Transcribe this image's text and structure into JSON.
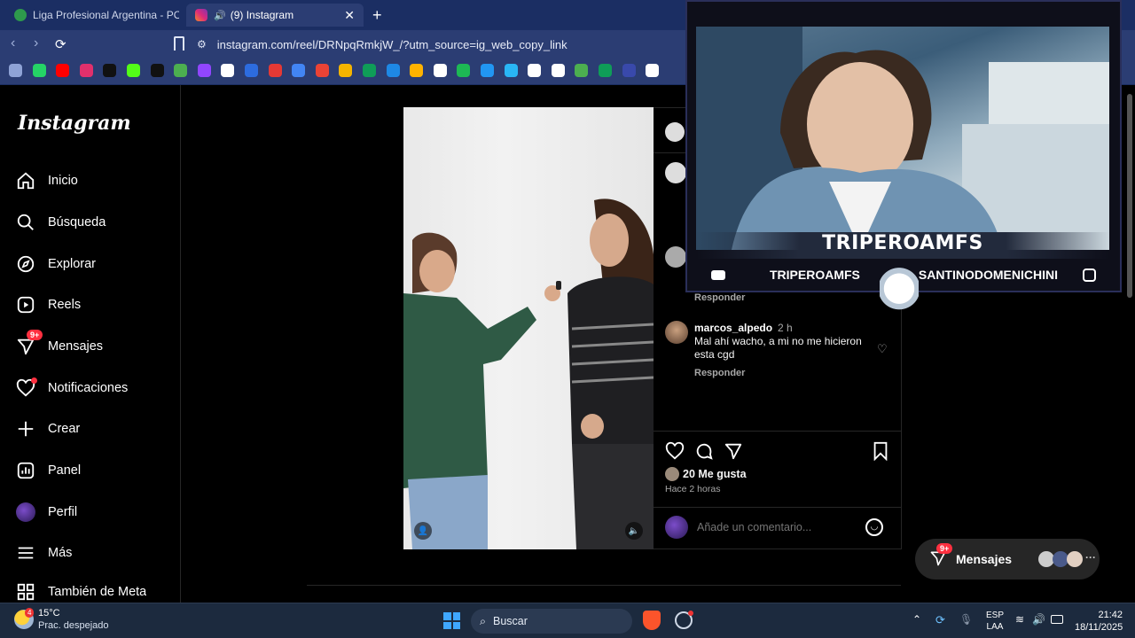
{
  "browser": {
    "tabs": [
      {
        "title": "Liga Profesional Argentina - POSICIO",
        "active": false
      },
      {
        "title": "(9) Instagram",
        "active": true
      }
    ],
    "new_tab": "+",
    "url": "instagram.com/reel/DRNpqRmkjW_/?utm_source=ig_web_copy_link"
  },
  "bookmarks": [
    "grid-icon",
    "whatsapp-icon",
    "youtube-icon",
    "instagram-icon",
    "tiktok-icon",
    "kick-icon",
    "x-icon",
    "app-icon",
    "twitch-icon",
    "google-icon",
    "app-icon",
    "app-icon",
    "docs-icon",
    "gmail-icon",
    "chart-icon",
    "drive-icon",
    "paypal-icon",
    "app-icon",
    "app-icon",
    "spotify-icon",
    "download-icon",
    "app-icon",
    "app-icon",
    "app-icon",
    "app-icon",
    "drive-icon",
    "app-icon",
    "google-icon"
  ],
  "sidebar": {
    "logo": "Instagram",
    "items": [
      {
        "label": "Inicio",
        "icon": "home-icon"
      },
      {
        "label": "Búsqueda",
        "icon": "search-icon"
      },
      {
        "label": "Explorar",
        "icon": "compass-icon"
      },
      {
        "label": "Reels",
        "icon": "reels-icon"
      },
      {
        "label": "Mensajes",
        "icon": "messenger-icon",
        "badge": "9+"
      },
      {
        "label": "Notificaciones",
        "icon": "heart-icon"
      },
      {
        "label": "Crear",
        "icon": "plus-icon"
      },
      {
        "label": "Panel",
        "icon": "chart-icon"
      },
      {
        "label": "Perfil",
        "icon": "avatar"
      },
      {
        "label": "Más",
        "icon": "menu-icon"
      },
      {
        "label": "También de Meta",
        "icon": "meta-icon"
      }
    ]
  },
  "comments": {
    "reply_label_1": "Responder",
    "comment": {
      "user": "marcos_alpedo",
      "time": "2 h",
      "text": "Mal ahí wacho, a mi no me hicieron esta cgd",
      "reply": "Responder"
    },
    "likes": "20 Me gusta",
    "posted": "Hace 2 horas",
    "input_placeholder": "Añade un comentario..."
  },
  "overlay": {
    "streamer": "TRIPEROAMFS",
    "youtube": "TRIPEROAMFS",
    "instagram": "SANTINODOMENICHINI"
  },
  "messages_pill": {
    "label": "Mensajes",
    "badge": "9+"
  },
  "taskbar": {
    "weather_temp": "15°C",
    "weather_desc": "Prac. despejado",
    "weather_badge": "4",
    "search_label": "Buscar",
    "lang_top": "ESP",
    "lang_bottom": "LAA",
    "time": "21:42",
    "date": "18/11/2025"
  },
  "colors": {
    "accent": "#ff3040",
    "browser_bg": "#2b3d73",
    "tab_bar": "#1b2e63"
  }
}
